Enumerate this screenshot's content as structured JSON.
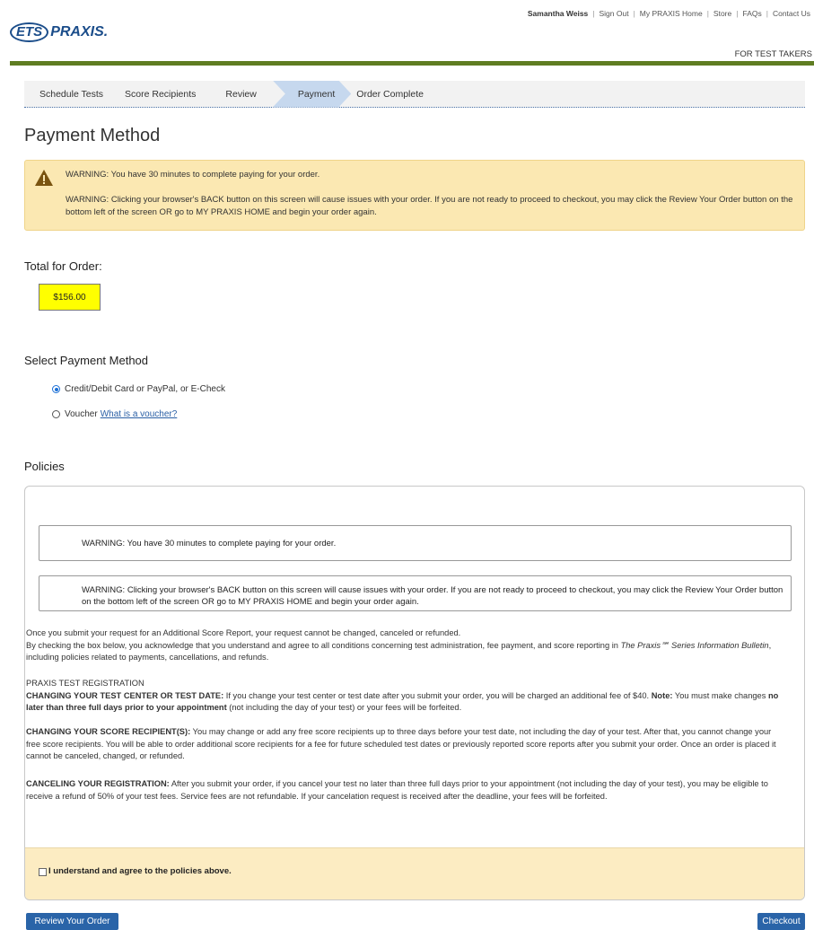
{
  "topnav": {
    "user": "Samantha Weiss",
    "links": [
      "Sign Out",
      "My PRAXIS Home",
      "Store",
      "FAQs",
      "Contact Us"
    ]
  },
  "logo": {
    "ets": "ETS",
    "praxis": "PRAXIS."
  },
  "header": {
    "for_test_takers": "FOR TEST TAKERS",
    "bar_color": "#5f7d22"
  },
  "steps": [
    {
      "label": "Schedule Tests",
      "active": false
    },
    {
      "label": "Score Recipients",
      "active": false
    },
    {
      "label": "Review",
      "active": false
    },
    {
      "label": "Payment",
      "active": true
    },
    {
      "label": "Order Complete",
      "active": false
    }
  ],
  "page_title": "Payment Method",
  "warning": {
    "icon": "warning-triangle-icon",
    "line1": "WARNING: You have 30 minutes to complete paying for your order.",
    "line2": "WARNING: Clicking your browser's BACK button on this screen will cause issues with your order. If you are not ready to proceed to checkout, you may click the Review Your Order button on the bottom left of the screen OR go to MY PRAXIS HOME and begin your order again."
  },
  "total": {
    "label": "Total for Order:",
    "amount": "$156.00"
  },
  "payment": {
    "label": "Select Payment Method",
    "options": [
      {
        "label": "Credit/Debit Card or PayPal, or E-Check",
        "selected": true
      },
      {
        "label": "Voucher",
        "selected": false,
        "link": "What is a voucher?"
      }
    ]
  },
  "policies": {
    "label": "Policies",
    "warn1": "WARNING: You have 30 minutes to complete paying for your order.",
    "warn2": "WARNING: Clicking your browser's BACK button on this screen will cause issues with your order. If you are not ready to proceed to checkout, you may click the Review Your Order button on the bottom left of the screen OR go to MY PRAXIS HOME and begin your order again.",
    "p1a": "Once you submit your request for an Additional Score Report, your request cannot be changed, canceled or refunded.",
    "p1b_pre": "By checking the box below, you acknowledge that you understand and agree to all conditions concerning test administration, fee payment, and score reporting in ",
    "p1b_italic": "The Praxis℠ Series Information Bulletin",
    "p1b_post": ", including policies related to payments, cancellations, and refunds.",
    "p2_heading": "PRAXIS TEST REGISTRATION",
    "p2_bold": "CHANGING YOUR TEST CENTER OR TEST DATE:",
    "p2_text": " If you change your test center or test date after you submit your order, you will be charged an additional fee of $40. ",
    "p2_note": "Note:",
    "p2_text2": " You must make changes ",
    "p2_bold2": "no later than three full days prior to your appointment",
    "p2_text3": " (not including the day of your test) or your fees will be forfeited.",
    "p3_bold": "CHANGING YOUR SCORE RECIPIENT(S):",
    "p3_text": " You may change or add any free score recipients up to three days before your test date, not including the day of your test. After that, you cannot change your free score recipients. You will be able to order additional score recipients for a fee for future scheduled test dates or previously reported score reports after you submit your order. Once an order is placed it cannot be canceled, changed, or refunded.",
    "p4_bold": "CANCELING YOUR REGISTRATION:",
    "p4_text": " After you submit your order, if you cancel your test no later than three full days prior to your appointment (not including the day of your test), you may be eligible to receive a refund of 50% of your test fees. Service fees are not refundable. If your cancelation request is received after the deadline, your fees will be forfeited.",
    "agree_label": "I understand and agree to the policies above."
  },
  "buttons": {
    "review": "Review Your Order",
    "checkout": "Checkout"
  }
}
